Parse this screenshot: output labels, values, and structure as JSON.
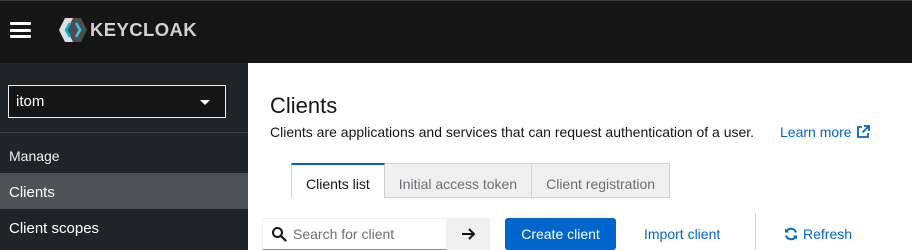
{
  "header": {
    "brand": "KEYCLOAK"
  },
  "sidebar": {
    "realm": "itom",
    "section": "Manage",
    "items": [
      {
        "label": "Clients",
        "active": true
      },
      {
        "label": "Client scopes",
        "active": false
      }
    ]
  },
  "main": {
    "title": "Clients",
    "description": "Clients are applications and services that can request authentication of a user.",
    "learn_more": "Learn more",
    "tabs": [
      {
        "label": "Clients list",
        "active": true
      },
      {
        "label": "Initial access token",
        "active": false
      },
      {
        "label": "Client registration",
        "active": false
      }
    ],
    "toolbar": {
      "search_placeholder": "Search for client",
      "create_label": "Create client",
      "import_label": "Import client",
      "refresh_label": "Refresh"
    }
  },
  "colors": {
    "masthead": "#151515",
    "sidebar": "#212427",
    "sidebar_active": "#4f5255",
    "accent": "#0066cc"
  },
  "icons": [
    "hamburger-icon",
    "keycloak-logo-icon",
    "caret-down-icon",
    "external-link-icon",
    "search-icon",
    "arrow-right-icon",
    "sync-icon"
  ]
}
